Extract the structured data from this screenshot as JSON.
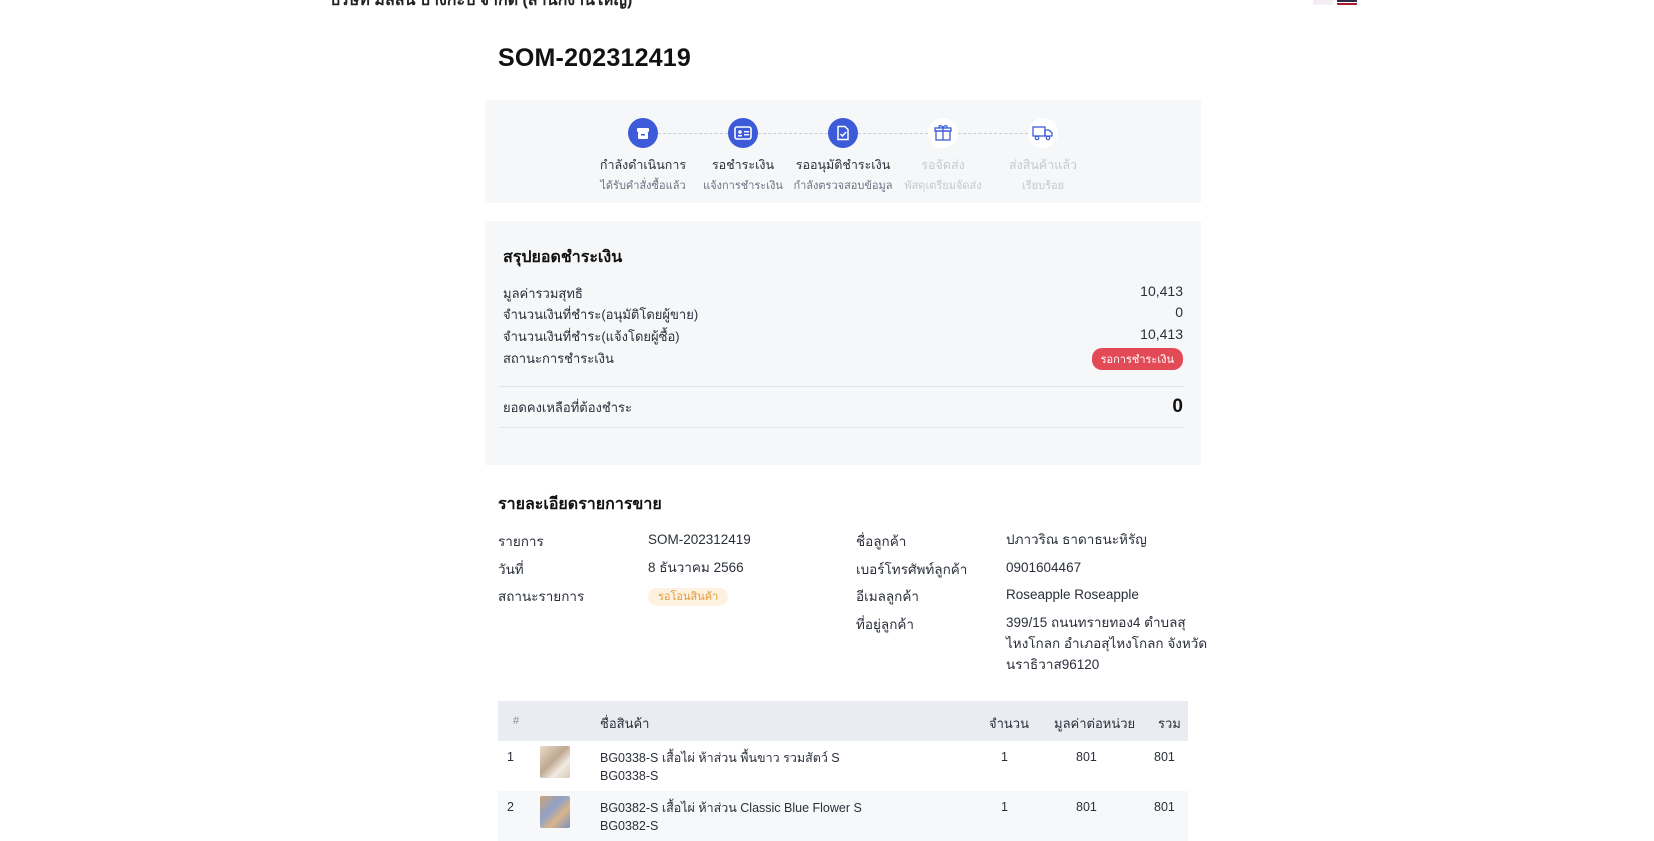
{
  "header": {
    "company": "บริษัท มิลลิน บางกะปิ จำกัด (สำนักงานใหญ่)",
    "order_no": "SOM-202312419"
  },
  "steps": [
    {
      "label": "กำลังดำเนินการ",
      "sub": "ได้รับคำสั่งซื้อแล้ว",
      "icon": "box-icon",
      "state": "done"
    },
    {
      "label": "รอชำระเงิน",
      "sub": "แจ้งการชำระเงิน",
      "icon": "id-card-icon",
      "state": "done"
    },
    {
      "label": "รออนุมัติชำระเงิน",
      "sub": "กำลังตรวจสอบข้อมูล",
      "icon": "document-check-icon",
      "state": "done"
    },
    {
      "label": "รอจัดส่ง",
      "sub": "พัสดุเตรียมจัดส่ง",
      "icon": "gift-icon",
      "state": "todo"
    },
    {
      "label": "ส่งสินค้าแล้ว",
      "sub": "เรียบร้อย",
      "icon": "truck-icon",
      "state": "todo"
    }
  ],
  "payment": {
    "title": "สรุปยอดชำระเงิน",
    "rows": [
      {
        "label": "มูลค่ารวมสุทธิ",
        "value": "10,413"
      },
      {
        "label": "จำนวนเงินที่ชำระ(อนุมัติโดยผู้ขาย)",
        "value": "0"
      },
      {
        "label": "จำนวนเงินที่ชำระ(แจ้งโดยผู้ซื้อ)",
        "value": "10,413"
      }
    ],
    "status_label": "สถานะการชำระเงิน",
    "status_badge": "รอการชำระเงิน",
    "remaining_label": "ยอดคงเหลือที่ต้องชำระ",
    "remaining_value": "0"
  },
  "details": {
    "title": "รายละเอียดรายการขาย",
    "item_label": "รายการ",
    "item_value": "SOM-202312419",
    "date_label": "วันที่",
    "date_value": "8 ธันวาคม 2566",
    "status_label": "สถานะรายการ",
    "status_badge": "รอโอนสินค้า",
    "customer_label": "ชื่อลูกค้า",
    "customer_value": "ปภาวริณ ธาดาธนะหิรัญ",
    "phone_label": "เบอร์โทรศัพท์ลูกค้า",
    "phone_value": "0901604467",
    "email_label": "อีเมลลูกค้า",
    "email_value": "Roseapple Roseapple",
    "address_label": "ที่อยู่ลูกค้า",
    "address_lines": [
      "399/15 ถนนทรายทอง4 ตำบลสุ",
      "ไหงโกลก อำเภอสุไหงโกลก จังหวัด",
      "นราธิวาส96120"
    ]
  },
  "table": {
    "headers": {
      "num": "#",
      "name": "ชื่อสินค้า",
      "qty": "จำนวน",
      "unit": "มูลค่าต่อหน่วย",
      "total": "รวม"
    },
    "rows": [
      {
        "num": "1",
        "name": "BG0338-S เสื้อไผ่ ห้าส่วน พื้นขาว รวมสัตว์ S",
        "sku": "BG0338-S",
        "qty": "1",
        "unit": "801",
        "total": "801"
      },
      {
        "num": "2",
        "name": "BG0382-S เสื้อไผ่ ห้าส่วน Classic Blue Flower S",
        "sku": "BG0382-S",
        "qty": "1",
        "unit": "801",
        "total": "801"
      }
    ]
  },
  "colors": {
    "primary": "#3d5bd9",
    "badge_red": "#e24a55",
    "badge_orange": "#fdf1e0"
  }
}
